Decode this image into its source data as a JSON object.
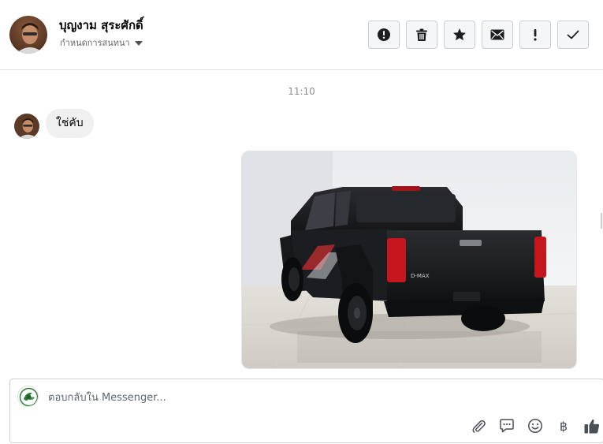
{
  "header": {
    "contact_name": "บุญงาม สุระศักดิ์",
    "subtitle": "กำหนดการสนทนา",
    "actions": [
      {
        "icon": "alert-circle-icon"
      },
      {
        "icon": "trash-icon"
      },
      {
        "icon": "star-icon"
      },
      {
        "icon": "envelope-icon"
      },
      {
        "icon": "exclamation-icon"
      },
      {
        "icon": "checkmark-icon"
      }
    ]
  },
  "conversation": {
    "timestamp": "11:10",
    "incoming_message": "ใช่คับ",
    "outgoing_attachment": {
      "type": "photo",
      "subject": "black pickup truck rear view"
    }
  },
  "composer": {
    "placeholder": "ตอบกลับใน Messenger...",
    "value": "",
    "baht_symbol": "฿",
    "tools": [
      "paperclip-icon",
      "chat-bubble-icon",
      "smiley-icon",
      "baht-icon",
      "thumbs-up-icon"
    ]
  },
  "colors": {
    "header_border": "#dcdfe3",
    "bubble_bg": "#f0f0f0",
    "button_bg": "#f5f6f7",
    "icon": "#1c1e21",
    "muted_text": "#8a8d91"
  }
}
